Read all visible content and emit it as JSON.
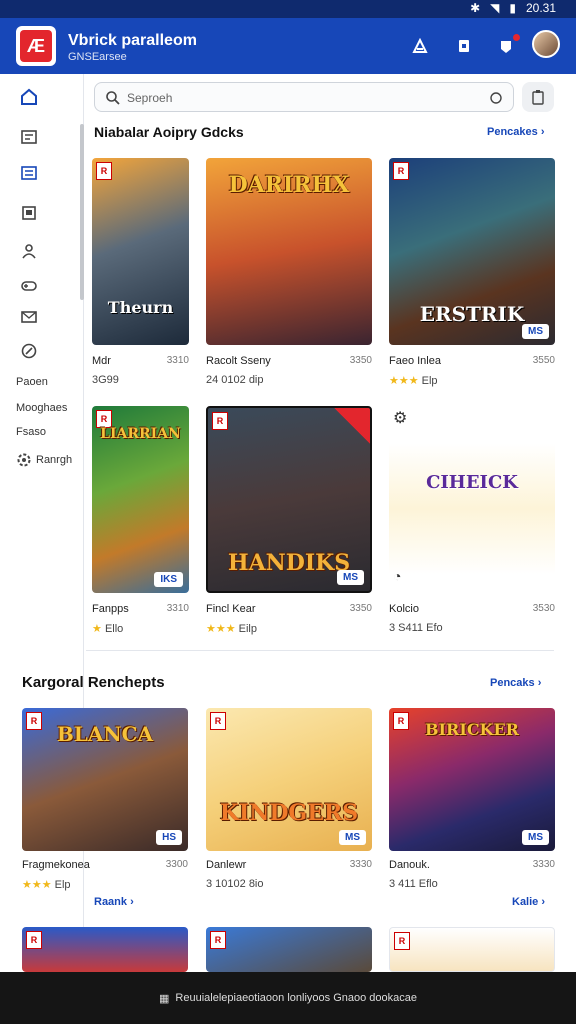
{
  "status": {
    "time": "20.31"
  },
  "app": {
    "title": "Vbrick paralleom",
    "subtitle": "GNSEarsee"
  },
  "sidebar": {
    "text_items": [
      "Paoen",
      "Mooghaes",
      "Fsaso"
    ],
    "settings_label": "Ranrgh"
  },
  "search": {
    "placeholder": "Seproeh"
  },
  "section1": {
    "title": "Niabalar  Aoipry Gdcks",
    "link": "Pencakes"
  },
  "section2": {
    "title": "Kargoral  Renchepts",
    "link": "Pencaks"
  },
  "cards1": [
    {
      "art": "Theurn",
      "name": "Mdr",
      "price": "3310",
      "meta": "3G99"
    },
    {
      "art": "DARIRHX",
      "name": "Racolt Sseny",
      "price": "3350",
      "meta": "24 0102 dip"
    },
    {
      "art": "ERSTRIK",
      "tag": "MS",
      "name": "Faeo Inlea",
      "price": "3550",
      "stars": "★★★",
      "meta": "Elp"
    },
    {
      "art": "LIARRIAN",
      "tag": "IKS",
      "name": "Fanpps",
      "price": "3310",
      "stars": "★",
      "meta": "Ello"
    },
    {
      "art": "HANDIKS",
      "tag": "MS",
      "name": "Fincl Kear",
      "price": "3350",
      "stars": "★★★",
      "meta": "Eilp"
    },
    {
      "art": "CIHEICK",
      "name": "Kolcio",
      "price": "3530",
      "meta": "3 S411 Efo"
    }
  ],
  "cards2": [
    {
      "art": "BLANCA",
      "tag": "HS",
      "name": "Fragmekonea",
      "price": "3300",
      "stars": "★★★",
      "meta": "Elp"
    },
    {
      "art": "KINDGERS",
      "tag": "MS",
      "name": "Danlewr",
      "price": "3330",
      "meta": "3 10102 8io"
    },
    {
      "art": "BIRICKER",
      "tag": "MS",
      "name": "Danouk.",
      "price": "3330",
      "meta": "3 411 Eflo"
    }
  ],
  "row_links": [
    "Raank",
    "Kalie"
  ],
  "bottom": {
    "text": "Reuuialelepiaeotiaoon  lonliyoos Gnaoo dookacae"
  }
}
